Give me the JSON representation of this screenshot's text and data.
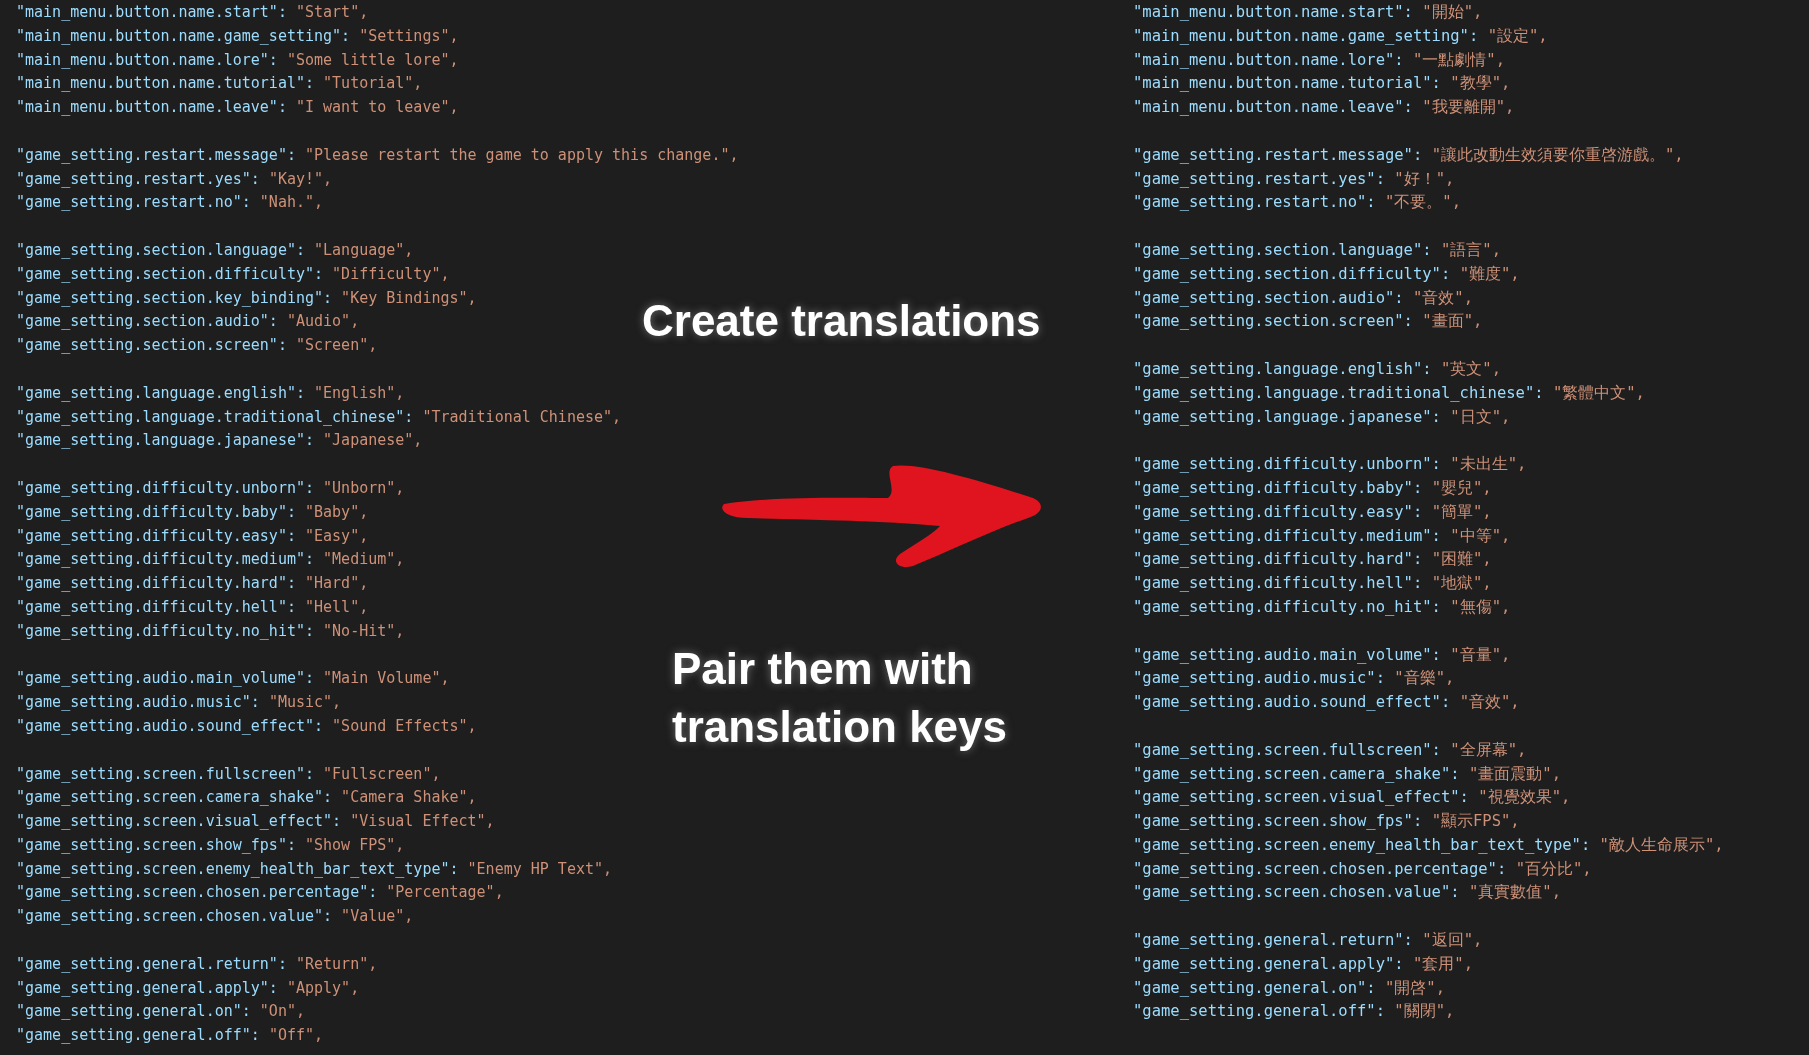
{
  "panels": [
    {
      "groups": [
        {
          "lines": [
            {
              "key": "\"main_menu.button.name.start\":",
              "value": "\"Start\","
            },
            {
              "key": "\"main_menu.button.name.game_setting\":",
              "value": "\"Settings\","
            },
            {
              "key": "\"main_menu.button.name.lore\":",
              "value": "\"Some little lore\","
            },
            {
              "key": "\"main_menu.button.name.tutorial\":",
              "value": "\"Tutorial\","
            },
            {
              "key": "\"main_menu.button.name.leave\":",
              "value": "\"I want to leave\","
            }
          ]
        },
        {
          "lines": [
            {
              "key": "\"game_setting.restart.message\":",
              "value": "\"Please restart the game to apply this change.\","
            },
            {
              "key": "\"game_setting.restart.yes\":",
              "value": "\"Kay!\","
            },
            {
              "key": "\"game_setting.restart.no\":",
              "value": "\"Nah.\","
            }
          ]
        },
        {
          "lines": [
            {
              "key": "\"game_setting.section.language\":",
              "value": "\"Language\","
            },
            {
              "key": "\"game_setting.section.difficulty\":",
              "value": "\"Difficulty\","
            },
            {
              "key": "\"game_setting.section.key_binding\":",
              "value": "\"Key Bindings\","
            },
            {
              "key": "\"game_setting.section.audio\":",
              "value": "\"Audio\","
            },
            {
              "key": "\"game_setting.section.screen\":",
              "value": "\"Screen\","
            }
          ]
        },
        {
          "lines": [
            {
              "key": "\"game_setting.language.english\":",
              "value": "\"English\","
            },
            {
              "key": "\"game_setting.language.traditional_chinese\":",
              "value": "\"Traditional Chinese\","
            },
            {
              "key": "\"game_setting.language.japanese\":",
              "value": "\"Japanese\","
            }
          ]
        },
        {
          "lines": [
            {
              "key": "\"game_setting.difficulty.unborn\":",
              "value": "\"Unborn\","
            },
            {
              "key": "\"game_setting.difficulty.baby\":",
              "value": "\"Baby\","
            },
            {
              "key": "\"game_setting.difficulty.easy\":",
              "value": "\"Easy\","
            },
            {
              "key": "\"game_setting.difficulty.medium\":",
              "value": "\"Medium\","
            },
            {
              "key": "\"game_setting.difficulty.hard\":",
              "value": "\"Hard\","
            },
            {
              "key": "\"game_setting.difficulty.hell\":",
              "value": "\"Hell\","
            },
            {
              "key": "\"game_setting.difficulty.no_hit\":",
              "value": "\"No-Hit\","
            }
          ]
        },
        {
          "lines": [
            {
              "key": "\"game_setting.audio.main_volume\":",
              "value": "\"Main Volume\","
            },
            {
              "key": "\"game_setting.audio.music\":",
              "value": "\"Music\","
            },
            {
              "key": "\"game_setting.audio.sound_effect\":",
              "value": "\"Sound Effects\","
            }
          ]
        },
        {
          "lines": [
            {
              "key": "\"game_setting.screen.fullscreen\":",
              "value": "\"Fullscreen\","
            },
            {
              "key": "\"game_setting.screen.camera_shake\":",
              "value": "\"Camera Shake\","
            },
            {
              "key": "\"game_setting.screen.visual_effect\":",
              "value": "\"Visual Effect\","
            },
            {
              "key": "\"game_setting.screen.show_fps\":",
              "value": "\"Show FPS\","
            },
            {
              "key": "\"game_setting.screen.enemy_health_bar_text_type\":",
              "value": "\"Enemy HP Text\","
            },
            {
              "key": "\"game_setting.screen.chosen.percentage\":",
              "value": "\"Percentage\","
            },
            {
              "key": "\"game_setting.screen.chosen.value\":",
              "value": "\"Value\","
            }
          ]
        },
        {
          "lines": [
            {
              "key": "\"game_setting.general.return\":",
              "value": "\"Return\","
            },
            {
              "key": "\"game_setting.general.apply\":",
              "value": "\"Apply\","
            },
            {
              "key": "\"game_setting.general.on\":",
              "value": "\"On\","
            },
            {
              "key": "\"game_setting.general.off\":",
              "value": "\"Off\","
            }
          ]
        }
      ]
    },
    {
      "groups": [
        {
          "lines": [
            {
              "key": "\"main_menu.button.name.start\":",
              "value": "\"開始\","
            },
            {
              "key": "\"main_menu.button.name.game_setting\":",
              "value": "\"設定\","
            },
            {
              "key": "\"main_menu.button.name.lore\":",
              "value": "\"一點劇情\","
            },
            {
              "key": "\"main_menu.button.name.tutorial\":",
              "value": "\"教學\","
            },
            {
              "key": "\"main_menu.button.name.leave\":",
              "value": "\"我要離開\","
            }
          ]
        },
        {
          "lines": [
            {
              "key": "\"game_setting.restart.message\":",
              "value": "\"讓此改動生效須要你重啓游戲。\","
            },
            {
              "key": "\"game_setting.restart.yes\":",
              "value": "\"好！\","
            },
            {
              "key": "\"game_setting.restart.no\":",
              "value": "\"不要。\","
            }
          ]
        },
        {
          "lines": [
            {
              "key": "\"game_setting.section.language\":",
              "value": "\"語言\","
            },
            {
              "key": "\"game_setting.section.difficulty\":",
              "value": "\"難度\","
            },
            {
              "key": "\"game_setting.section.audio\":",
              "value": "\"音效\","
            },
            {
              "key": "\"game_setting.section.screen\":",
              "value": "\"畫面\","
            }
          ]
        },
        {
          "lines": [
            {
              "key": "\"game_setting.language.english\":",
              "value": "\"英文\","
            },
            {
              "key": "\"game_setting.language.traditional_chinese\":",
              "value": "\"繁體中文\","
            },
            {
              "key": "\"game_setting.language.japanese\":",
              "value": "\"日文\","
            }
          ]
        },
        {
          "lines": [
            {
              "key": "\"game_setting.difficulty.unborn\":",
              "value": "\"未出生\","
            },
            {
              "key": "\"game_setting.difficulty.baby\":",
              "value": "\"嬰兒\","
            },
            {
              "key": "\"game_setting.difficulty.easy\":",
              "value": "\"簡單\","
            },
            {
              "key": "\"game_setting.difficulty.medium\":",
              "value": "\"中等\","
            },
            {
              "key": "\"game_setting.difficulty.hard\":",
              "value": "\"困難\","
            },
            {
              "key": "\"game_setting.difficulty.hell\":",
              "value": "\"地獄\","
            },
            {
              "key": "\"game_setting.difficulty.no_hit\":",
              "value": "\"無傷\","
            }
          ]
        },
        {
          "lines": [
            {
              "key": "\"game_setting.audio.main_volume\":",
              "value": "\"音量\","
            },
            {
              "key": "\"game_setting.audio.music\":",
              "value": "\"音樂\","
            },
            {
              "key": "\"game_setting.audio.sound_effect\":",
              "value": "\"音效\","
            }
          ]
        },
        {
          "lines": [
            {
              "key": "\"game_setting.screen.fullscreen\":",
              "value": "\"全屏幕\","
            },
            {
              "key": "\"game_setting.screen.camera_shake\":",
              "value": "\"畫面震動\","
            },
            {
              "key": "\"game_setting.screen.visual_effect\":",
              "value": "\"視覺效果\","
            },
            {
              "key": "\"game_setting.screen.show_fps\":",
              "value": "\"顯示FPS\","
            },
            {
              "key": "\"game_setting.screen.enemy_health_bar_text_type\":",
              "value": "\"敵人生命展示\","
            },
            {
              "key": "\"game_setting.screen.chosen.percentage\":",
              "value": "\"百分比\","
            },
            {
              "key": "\"game_setting.screen.chosen.value\":",
              "value": "\"真實數值\","
            }
          ]
        },
        {
          "lines": [
            {
              "key": "\"game_setting.general.return\":",
              "value": "\"返回\","
            },
            {
              "key": "\"game_setting.general.apply\":",
              "value": "\"套用\","
            },
            {
              "key": "\"game_setting.general.on\":",
              "value": "\"開啓\","
            },
            {
              "key": "\"game_setting.general.off\":",
              "value": "\"關閉\","
            }
          ]
        }
      ]
    }
  ],
  "captions": [
    "Create translations",
    "Pair them with translation keys"
  ]
}
